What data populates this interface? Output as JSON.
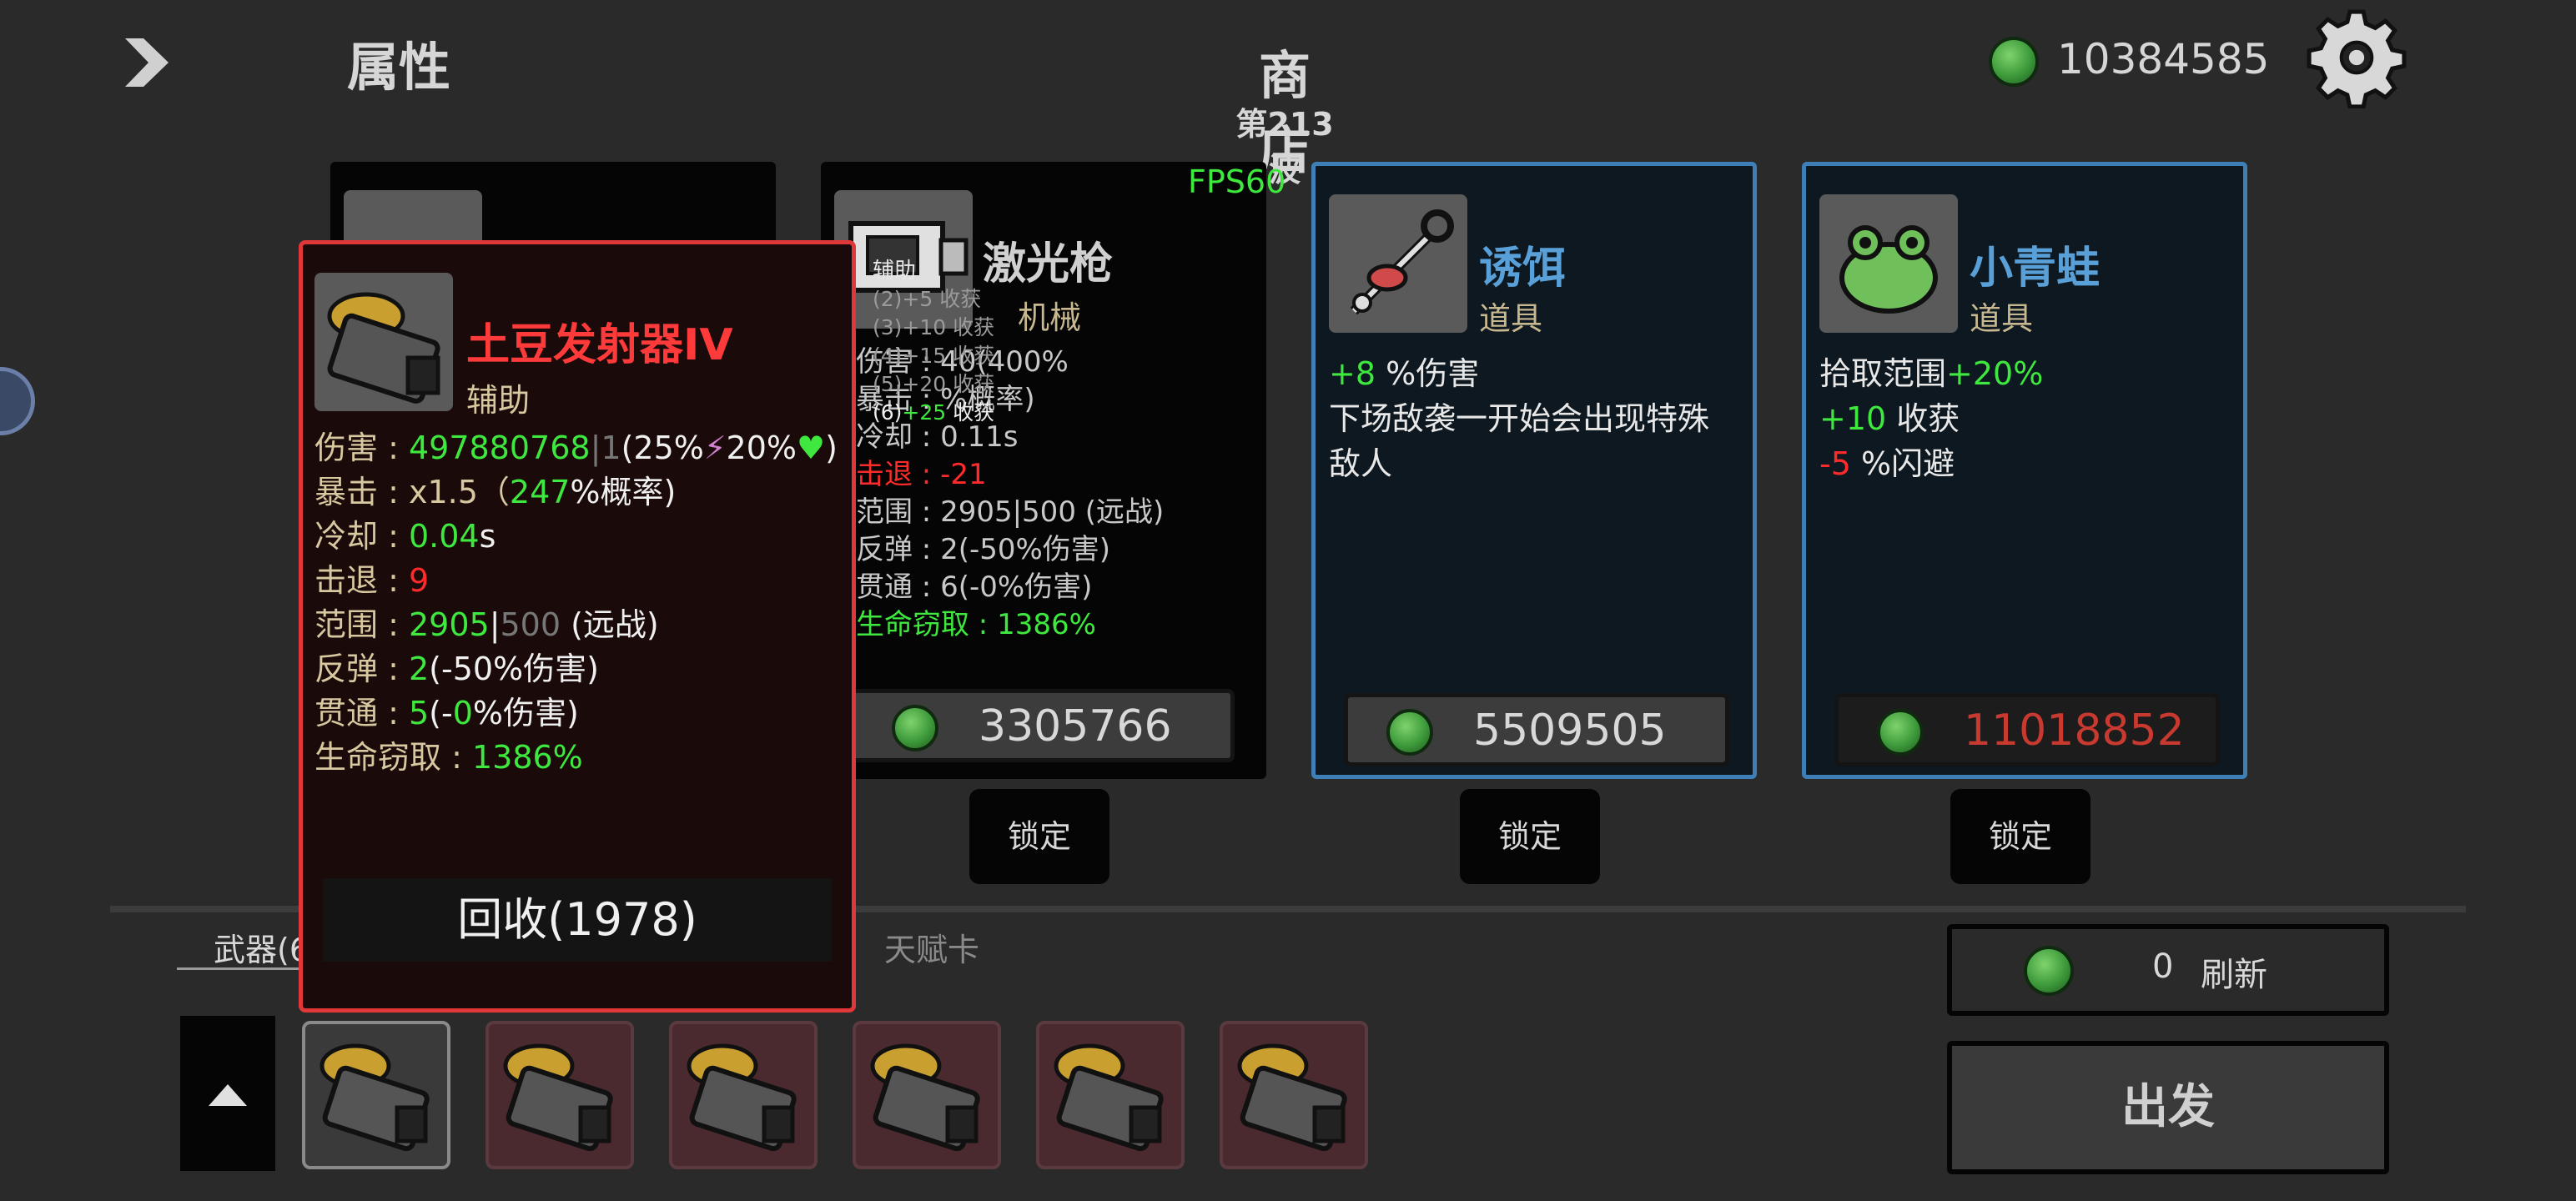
{
  "header": {
    "attributes_label": "属性",
    "shop_title": "商店",
    "wave_label": "第213波",
    "money": "10384585",
    "fps": "FPS60"
  },
  "shop": {
    "cards": [
      {
        "name": "激光枪",
        "category": "机械",
        "price": "3305766",
        "lock_label": "锁定",
        "stats": [
          "伤害 : 40(400%",
          "暴击 : %概率)",
          "冷却 : 0.11s",
          "击退 : -21",
          "范围 : 2905|500 (远战)",
          "反弹 : 2(-50%伤害)",
          "贯通 : 6(-0%伤害)",
          "生命窃取 : 1386%"
        ]
      },
      {
        "name": "诱饵",
        "category": "道具",
        "price": "5509505",
        "lock_label": "锁定",
        "desc_lines": [
          "+8 %伤害",
          "下场敌袭一开始会出现特殊",
          "敌人"
        ]
      },
      {
        "name": "小青蛙",
        "category": "道具",
        "price": "11018852",
        "price_color": "#c83a30",
        "lock_label": "锁定",
        "desc_lines": [
          "拾取范围+20%",
          "+10 收获",
          "-5 %闪避"
        ]
      }
    ]
  },
  "tooltip": {
    "name": "土豆发射器IV",
    "category": "辅助",
    "damage_label": "伤害 : ",
    "damage_value": "497880768",
    "damage_base": "1",
    "damage_scaling": "(25%",
    "damage_scaling2": "20%",
    "crit_label": "暴击 :  x1.5（",
    "crit_value": "247",
    "crit_suffix": "%概率)",
    "cooldown_label": "冷却 : ",
    "cooldown_value": "0.04",
    "cooldown_unit": "s",
    "knockback_label": "击退 : ",
    "knockback_value": "9",
    "range_label": "范围 : ",
    "range_value": "2905",
    "range_base": "500",
    "range_type": " (远战)",
    "bounce_label": "反弹 : ",
    "bounce_value": "2",
    "bounce_suffix": "(-50%伤害)",
    "pierce_label": "贯通 : ",
    "pierce_value": "5",
    "pierce_suffix_a": "(-",
    "pierce_suffix_b": "0",
    "pierce_suffix_c": "%伤害)",
    "lifesteal_label": "生命窃取 : ",
    "lifesteal_value": "1386%",
    "recycle_label": "回收(1978)"
  },
  "bonus_popup": {
    "title": "辅助",
    "lines": [
      "(2)+5 收获",
      "(3)+10 收获",
      "(4)+15 收获",
      "(5)+20 收获"
    ],
    "current_prefix": "(6)",
    "current_value": "+25",
    "current_suffix": " 收获"
  },
  "bottom": {
    "tab_weapons": "武器(6",
    "tab_talent": "天赋卡",
    "refresh_cost": "0",
    "refresh_label": "刷新",
    "go_label": "出发",
    "weapon_slots": 6
  },
  "colors": {
    "green": "#3ee83e",
    "red": "#ff2a2a",
    "blue_border": "#3e7fb8",
    "tooltip_border": "#e03838"
  },
  "icons": [
    "chevron-right-icon",
    "gear-icon",
    "coin-icon",
    "potato-launcher-icon",
    "laser-gun-icon",
    "bait-icon",
    "frog-icon",
    "arrow-up-icon"
  ]
}
